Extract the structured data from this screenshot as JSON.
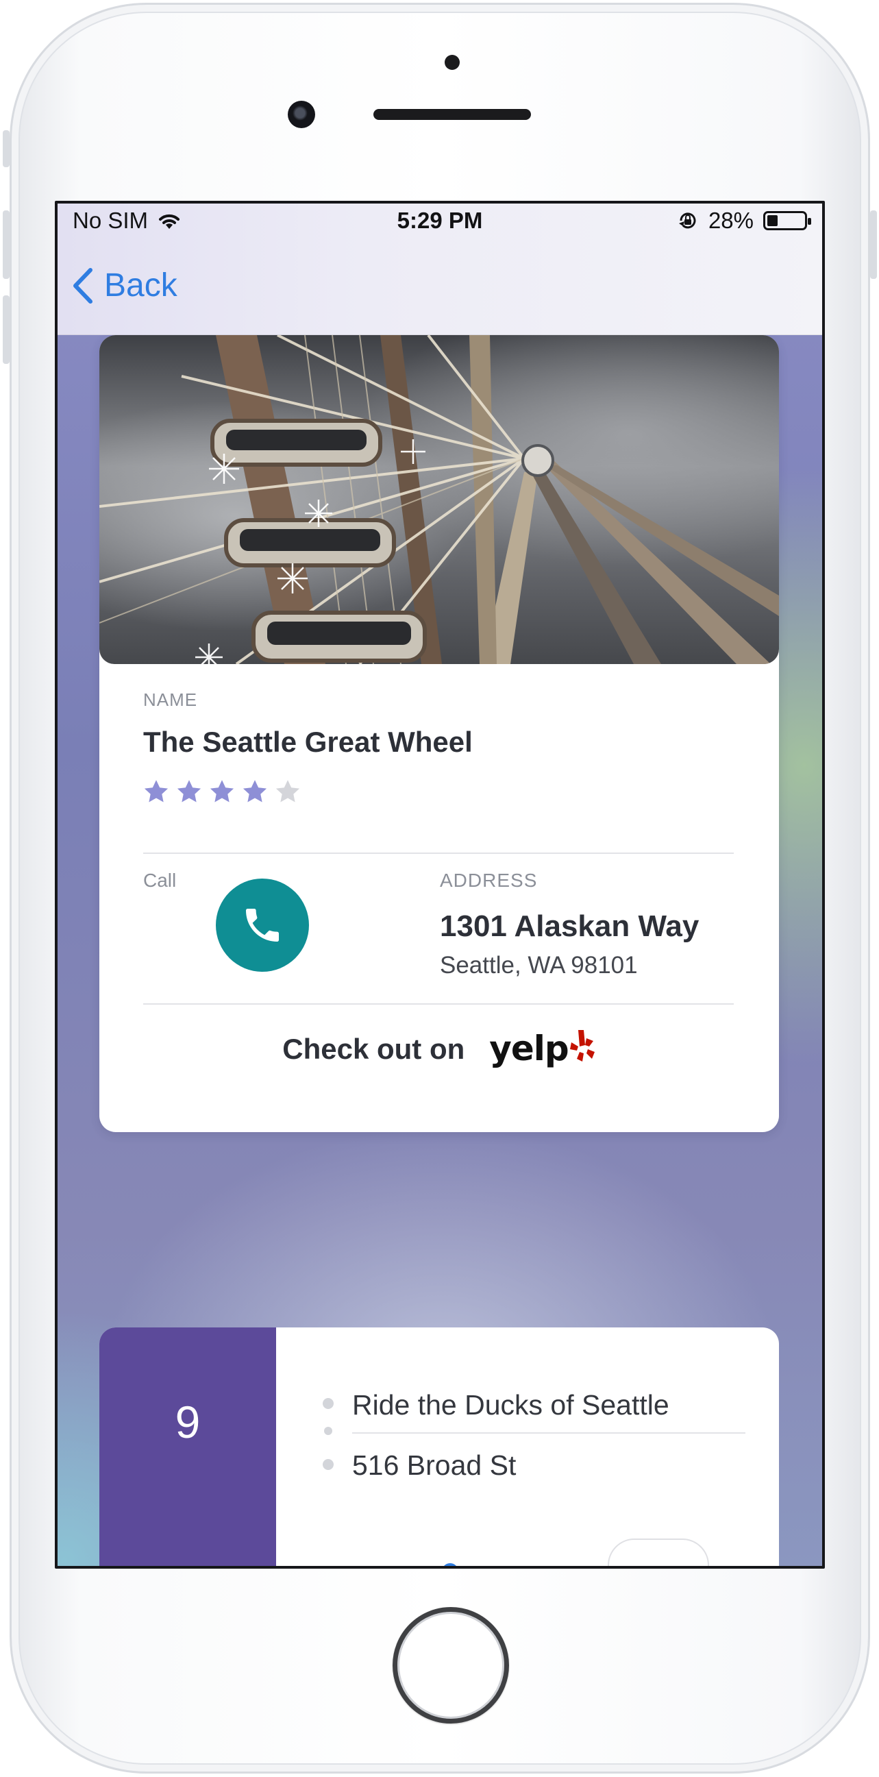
{
  "status_bar": {
    "carrier": "No SIM",
    "time": "5:29 PM",
    "battery_percent": "28%",
    "battery_level": 0.28
  },
  "nav": {
    "back_label": "Back"
  },
  "place": {
    "name_label": "NAME",
    "name": "The Seattle Great Wheel",
    "rating": 4,
    "rating_max": 5,
    "call_label": "Call",
    "address_label": "ADDRESS",
    "address_line1": "1301 Alaskan Way",
    "address_line2": "Seattle, WA 98101",
    "yelp_prompt": "Check out on",
    "yelp_brand": "yelp"
  },
  "next_item": {
    "index": "9",
    "title": "Ride the Ducks of Seattle",
    "address": "516 Broad St"
  },
  "colors": {
    "accent_blue": "#2f7de1",
    "call_teal": "#0f8e94",
    "star_active": "#8e8fd6",
    "star_inactive": "#d4d5da",
    "index_purple": "#5c4a9a",
    "yelp_red": "#c41200"
  },
  "icons": [
    "wifi-icon",
    "orientation-lock-icon",
    "battery-icon",
    "chevron-left-icon",
    "phone-icon",
    "star-icon",
    "yelp-burst-icon"
  ]
}
